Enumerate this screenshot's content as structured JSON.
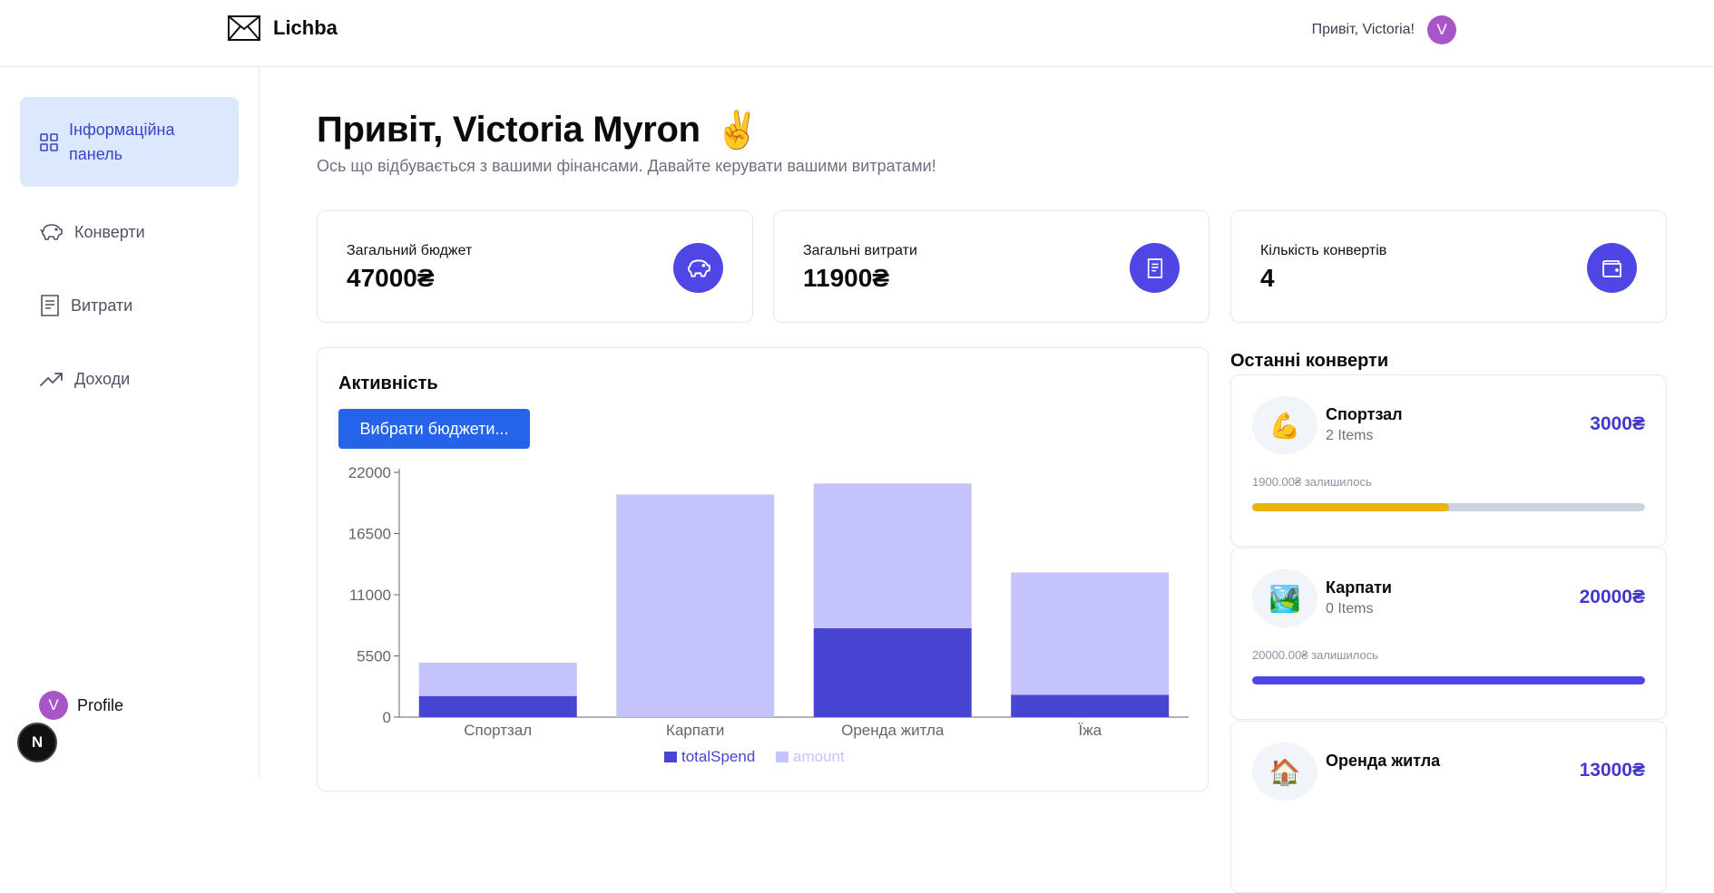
{
  "header": {
    "app_name": "Lichba",
    "greeting": "Привіт, Victoria!",
    "avatar_letter": "V"
  },
  "sidebar": {
    "items": [
      {
        "label": "Інформаційна панель",
        "icon": "grid-icon",
        "active": true
      },
      {
        "label": "Конверти",
        "icon": "piggy-bank-icon",
        "active": false
      },
      {
        "label": "Витрати",
        "icon": "receipt-icon",
        "active": false
      },
      {
        "label": "Доходи",
        "icon": "trending-up-icon",
        "active": false
      }
    ],
    "profile_label": "Profile",
    "profile_letter": "V",
    "next_badge": "N"
  },
  "main": {
    "title": "Привіт, Victoria Myron",
    "title_emoji": "✌️",
    "subtitle": "Ось що відбувається з вашими фінансами. Давайте керувати вашими витратами!"
  },
  "stats": [
    {
      "label": "Загальний бюджет",
      "value": "47000₴",
      "icon": "piggy-bank-icon"
    },
    {
      "label": "Загальні витрати",
      "value": "11900₴",
      "icon": "receipt-icon"
    },
    {
      "label": "Кількість конвертів",
      "value": "4",
      "icon": "wallet-icon"
    }
  ],
  "activity": {
    "title": "Активність",
    "select_button": "Вибрати бюджети..."
  },
  "chart_data": {
    "type": "bar",
    "stacked": true,
    "categories": [
      "Спортзал",
      "Карпати",
      "Оренда житла",
      "Їжа"
    ],
    "series": [
      {
        "name": "totalSpend",
        "values": [
          1900,
          0,
          8000,
          2000
        ],
        "color": "#4845d2"
      },
      {
        "name": "amount",
        "values": [
          3000,
          20000,
          13000,
          11000
        ],
        "color": "#c4c3fb"
      }
    ],
    "yticks": [
      0,
      5500,
      11000,
      16500,
      22000
    ],
    "ylim": [
      0,
      22000
    ],
    "legend": "bottom"
  },
  "recent": {
    "title": "Останні конверти",
    "envelopes": [
      {
        "emoji": "💪",
        "name": "Спортзал",
        "items": "2 Items",
        "amount": "3000₴",
        "remaining": "1900.00₴ залишилось",
        "progress": 0.5,
        "color": "#eab308"
      },
      {
        "emoji": "🏞️",
        "name": "Карпати",
        "items": "0 Items",
        "amount": "20000₴",
        "remaining": "20000.00₴ залишилось",
        "progress": 1.0,
        "color": "#4f46e5"
      },
      {
        "emoji": "🏠",
        "name": "Оренда житла",
        "items": "",
        "amount": "13000₴",
        "remaining": "",
        "progress": 0,
        "color": "#4f46e5"
      }
    ]
  }
}
